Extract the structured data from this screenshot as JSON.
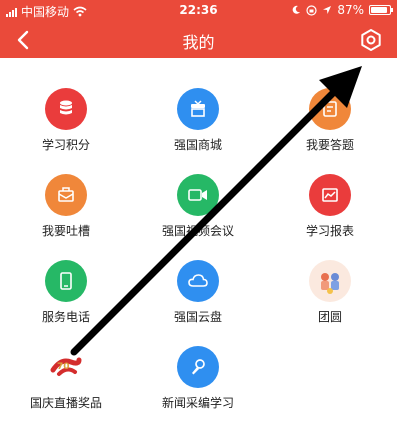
{
  "status_bar": {
    "carrier": "中国移动",
    "time": "22:36",
    "battery_percent": "87%",
    "battery_level": 0.87
  },
  "nav": {
    "title": "我的",
    "back_icon": "chevron-left-icon",
    "settings_icon": "gear-icon"
  },
  "menu": {
    "items": [
      {
        "label": "学习积分",
        "icon": "database-icon",
        "color": "#ea3c3c"
      },
      {
        "label": "强国商城",
        "icon": "shop-icon",
        "color": "#2f8ff0"
      },
      {
        "label": "我要答题",
        "icon": "quiz-icon",
        "color": "#f0873a"
      },
      {
        "label": "我要吐槽",
        "icon": "feedback-mail-icon",
        "color": "#f0873a"
      },
      {
        "label": "强国视频会议",
        "icon": "video-call-icon",
        "color": "#26b866"
      },
      {
        "label": "学习报表",
        "icon": "report-chart-icon",
        "color": "#ea3c3c"
      },
      {
        "label": "服务电话",
        "icon": "phone-icon",
        "color": "#26b866"
      },
      {
        "label": "强国云盘",
        "icon": "cloud-icon",
        "color": "#2f8ff0"
      },
      {
        "label": "团圆",
        "icon": "reunion-illustration-icon",
        "color": "#fbe9df"
      },
      {
        "label": "国庆直播奖品",
        "icon": "anniversary-ribbon-icon",
        "color": "#d42d2d"
      },
      {
        "label": "新闻采编学习",
        "icon": "microphone-icon",
        "color": "#2f8ff0"
      }
    ]
  }
}
